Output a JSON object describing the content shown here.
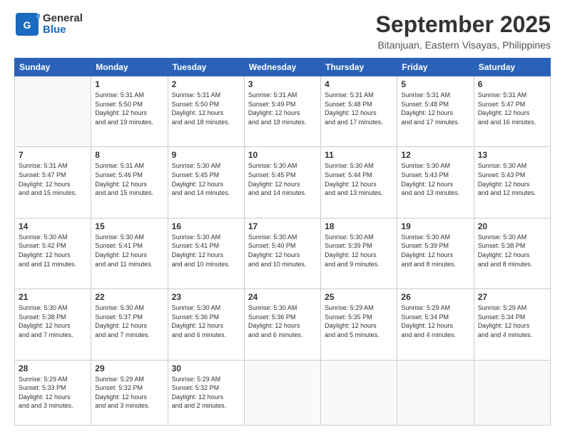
{
  "header": {
    "logo_line1": "General",
    "logo_line2": "Blue",
    "month": "September 2025",
    "location": "Bitanjuan, Eastern Visayas, Philippines"
  },
  "weekdays": [
    "Sunday",
    "Monday",
    "Tuesday",
    "Wednesday",
    "Thursday",
    "Friday",
    "Saturday"
  ],
  "weeks": [
    [
      {
        "day": "",
        "sunrise": "",
        "sunset": "",
        "daylight": ""
      },
      {
        "day": "1",
        "sunrise": "Sunrise: 5:31 AM",
        "sunset": "Sunset: 5:50 PM",
        "daylight": "Daylight: 12 hours and 19 minutes."
      },
      {
        "day": "2",
        "sunrise": "Sunrise: 5:31 AM",
        "sunset": "Sunset: 5:50 PM",
        "daylight": "Daylight: 12 hours and 18 minutes."
      },
      {
        "day": "3",
        "sunrise": "Sunrise: 5:31 AM",
        "sunset": "Sunset: 5:49 PM",
        "daylight": "Daylight: 12 hours and 18 minutes."
      },
      {
        "day": "4",
        "sunrise": "Sunrise: 5:31 AM",
        "sunset": "Sunset: 5:48 PM",
        "daylight": "Daylight: 12 hours and 17 minutes."
      },
      {
        "day": "5",
        "sunrise": "Sunrise: 5:31 AM",
        "sunset": "Sunset: 5:48 PM",
        "daylight": "Daylight: 12 hours and 17 minutes."
      },
      {
        "day": "6",
        "sunrise": "Sunrise: 5:31 AM",
        "sunset": "Sunset: 5:47 PM",
        "daylight": "Daylight: 12 hours and 16 minutes."
      }
    ],
    [
      {
        "day": "7",
        "sunrise": "Sunrise: 5:31 AM",
        "sunset": "Sunset: 5:47 PM",
        "daylight": "Daylight: 12 hours and 15 minutes."
      },
      {
        "day": "8",
        "sunrise": "Sunrise: 5:31 AM",
        "sunset": "Sunset: 5:46 PM",
        "daylight": "Daylight: 12 hours and 15 minutes."
      },
      {
        "day": "9",
        "sunrise": "Sunrise: 5:30 AM",
        "sunset": "Sunset: 5:45 PM",
        "daylight": "Daylight: 12 hours and 14 minutes."
      },
      {
        "day": "10",
        "sunrise": "Sunrise: 5:30 AM",
        "sunset": "Sunset: 5:45 PM",
        "daylight": "Daylight: 12 hours and 14 minutes."
      },
      {
        "day": "11",
        "sunrise": "Sunrise: 5:30 AM",
        "sunset": "Sunset: 5:44 PM",
        "daylight": "Daylight: 12 hours and 13 minutes."
      },
      {
        "day": "12",
        "sunrise": "Sunrise: 5:30 AM",
        "sunset": "Sunset: 5:43 PM",
        "daylight": "Daylight: 12 hours and 13 minutes."
      },
      {
        "day": "13",
        "sunrise": "Sunrise: 5:30 AM",
        "sunset": "Sunset: 5:43 PM",
        "daylight": "Daylight: 12 hours and 12 minutes."
      }
    ],
    [
      {
        "day": "14",
        "sunrise": "Sunrise: 5:30 AM",
        "sunset": "Sunset: 5:42 PM",
        "daylight": "Daylight: 12 hours and 11 minutes."
      },
      {
        "day": "15",
        "sunrise": "Sunrise: 5:30 AM",
        "sunset": "Sunset: 5:41 PM",
        "daylight": "Daylight: 12 hours and 11 minutes."
      },
      {
        "day": "16",
        "sunrise": "Sunrise: 5:30 AM",
        "sunset": "Sunset: 5:41 PM",
        "daylight": "Daylight: 12 hours and 10 minutes."
      },
      {
        "day": "17",
        "sunrise": "Sunrise: 5:30 AM",
        "sunset": "Sunset: 5:40 PM",
        "daylight": "Daylight: 12 hours and 10 minutes."
      },
      {
        "day": "18",
        "sunrise": "Sunrise: 5:30 AM",
        "sunset": "Sunset: 5:39 PM",
        "daylight": "Daylight: 12 hours and 9 minutes."
      },
      {
        "day": "19",
        "sunrise": "Sunrise: 5:30 AM",
        "sunset": "Sunset: 5:39 PM",
        "daylight": "Daylight: 12 hours and 8 minutes."
      },
      {
        "day": "20",
        "sunrise": "Sunrise: 5:30 AM",
        "sunset": "Sunset: 5:38 PM",
        "daylight": "Daylight: 12 hours and 8 minutes."
      }
    ],
    [
      {
        "day": "21",
        "sunrise": "Sunrise: 5:30 AM",
        "sunset": "Sunset: 5:38 PM",
        "daylight": "Daylight: 12 hours and 7 minutes."
      },
      {
        "day": "22",
        "sunrise": "Sunrise: 5:30 AM",
        "sunset": "Sunset: 5:37 PM",
        "daylight": "Daylight: 12 hours and 7 minutes."
      },
      {
        "day": "23",
        "sunrise": "Sunrise: 5:30 AM",
        "sunset": "Sunset: 5:36 PM",
        "daylight": "Daylight: 12 hours and 6 minutes."
      },
      {
        "day": "24",
        "sunrise": "Sunrise: 5:30 AM",
        "sunset": "Sunset: 5:36 PM",
        "daylight": "Daylight: 12 hours and 6 minutes."
      },
      {
        "day": "25",
        "sunrise": "Sunrise: 5:29 AM",
        "sunset": "Sunset: 5:35 PM",
        "daylight": "Daylight: 12 hours and 5 minutes."
      },
      {
        "day": "26",
        "sunrise": "Sunrise: 5:29 AM",
        "sunset": "Sunset: 5:34 PM",
        "daylight": "Daylight: 12 hours and 4 minutes."
      },
      {
        "day": "27",
        "sunrise": "Sunrise: 5:29 AM",
        "sunset": "Sunset: 5:34 PM",
        "daylight": "Daylight: 12 hours and 4 minutes."
      }
    ],
    [
      {
        "day": "28",
        "sunrise": "Sunrise: 5:29 AM",
        "sunset": "Sunset: 5:33 PM",
        "daylight": "Daylight: 12 hours and 3 minutes."
      },
      {
        "day": "29",
        "sunrise": "Sunrise: 5:29 AM",
        "sunset": "Sunset: 5:32 PM",
        "daylight": "Daylight: 12 hours and 3 minutes."
      },
      {
        "day": "30",
        "sunrise": "Sunrise: 5:29 AM",
        "sunset": "Sunset: 5:32 PM",
        "daylight": "Daylight: 12 hours and 2 minutes."
      },
      {
        "day": "",
        "sunrise": "",
        "sunset": "",
        "daylight": ""
      },
      {
        "day": "",
        "sunrise": "",
        "sunset": "",
        "daylight": ""
      },
      {
        "day": "",
        "sunrise": "",
        "sunset": "",
        "daylight": ""
      },
      {
        "day": "",
        "sunrise": "",
        "sunset": "",
        "daylight": ""
      }
    ]
  ]
}
